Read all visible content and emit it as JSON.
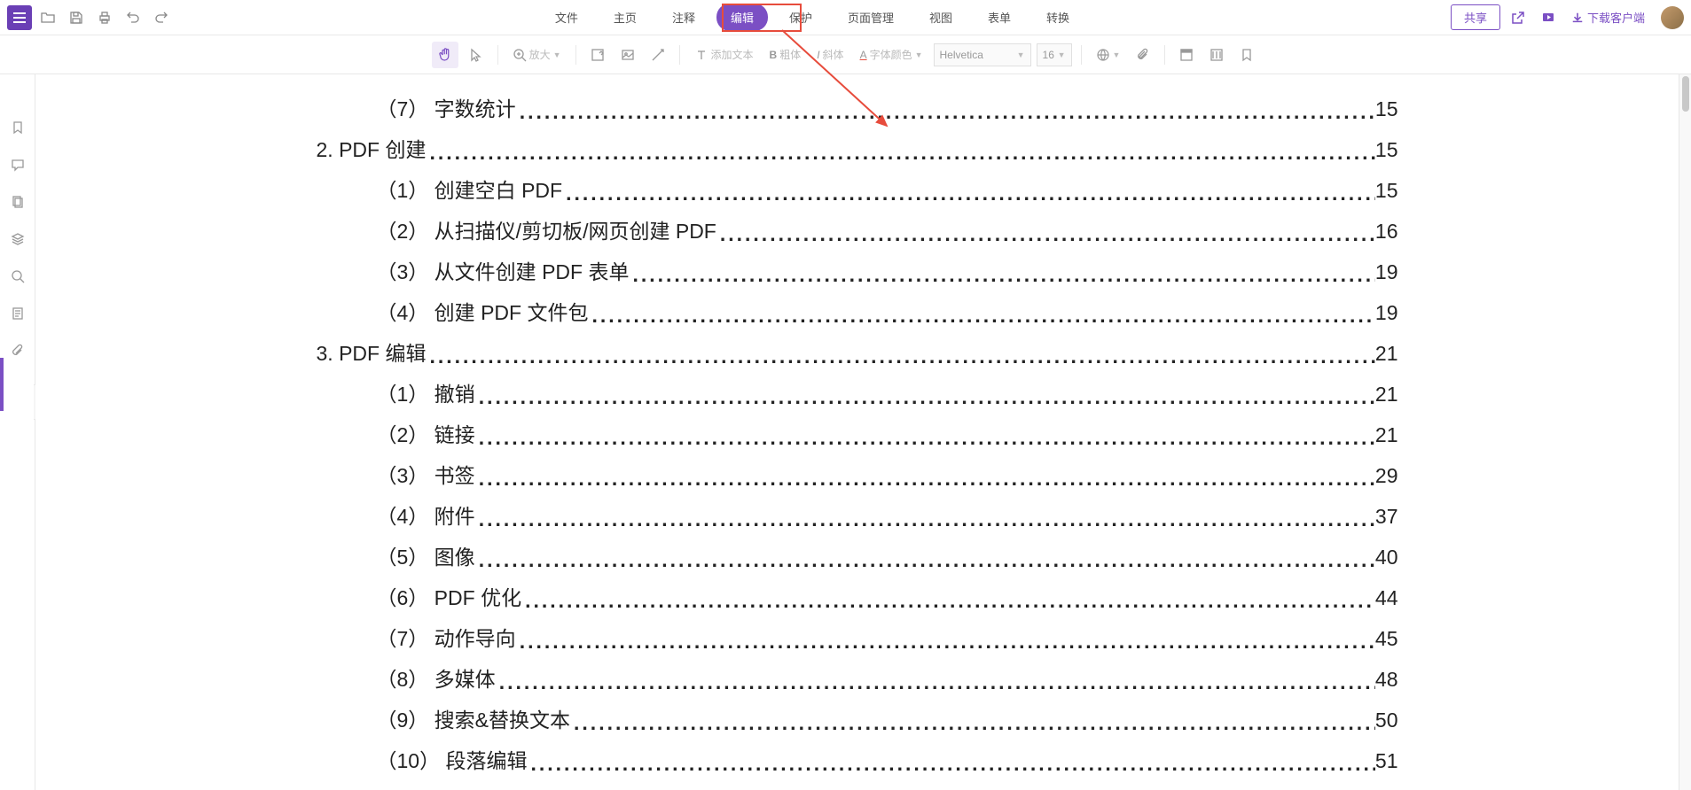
{
  "topbar": {
    "tabs": [
      "文件",
      "主页",
      "注释",
      "编辑",
      "保护",
      "页面管理",
      "视图",
      "表单",
      "转换"
    ],
    "active_tab_index": 3,
    "share_label": "共享",
    "download_label": "下载客户端"
  },
  "toolbar": {
    "zoom_label": "放大",
    "add_text_label": "添加文本",
    "bold_label": "粗体",
    "italic_label": "斜体",
    "font_color_label": "字体颜色",
    "font_family": "Helvetica",
    "font_size": "16"
  },
  "toc": [
    {
      "indent": 2,
      "label": "（7） 字数统计",
      "page": "15"
    },
    {
      "indent": 1,
      "label": "2.  PDF 创建",
      "page": "15"
    },
    {
      "indent": 2,
      "label": "（1） 创建空白 PDF",
      "page": "15"
    },
    {
      "indent": 2,
      "label": "（2） 从扫描仪/剪切板/网页创建 PDF",
      "page": "16"
    },
    {
      "indent": 2,
      "label": "（3） 从文件创建 PDF 表单",
      "page": "19"
    },
    {
      "indent": 2,
      "label": "（4） 创建 PDF 文件包",
      "page": "19"
    },
    {
      "indent": 1,
      "label": "3.  PDF 编辑",
      "page": "21"
    },
    {
      "indent": 2,
      "label": "（1）  撤销",
      "page": "21"
    },
    {
      "indent": 2,
      "label": "（2）  链接",
      "page": "21"
    },
    {
      "indent": 2,
      "label": "（3）  书签",
      "page": "29"
    },
    {
      "indent": 2,
      "label": "（4）  附件",
      "page": "37"
    },
    {
      "indent": 2,
      "label": "（5）  图像",
      "page": "40"
    },
    {
      "indent": 2,
      "label": "（6）  PDF 优化",
      "page": "44"
    },
    {
      "indent": 2,
      "label": "（7）  动作导向",
      "page": "45"
    },
    {
      "indent": 2,
      "label": "（8）  多媒体",
      "page": "48"
    },
    {
      "indent": 2,
      "label": "（9）  搜索&替换文本",
      "page": "50"
    },
    {
      "indent": 2,
      "label": "（10）  段落编辑",
      "page": "51"
    }
  ]
}
